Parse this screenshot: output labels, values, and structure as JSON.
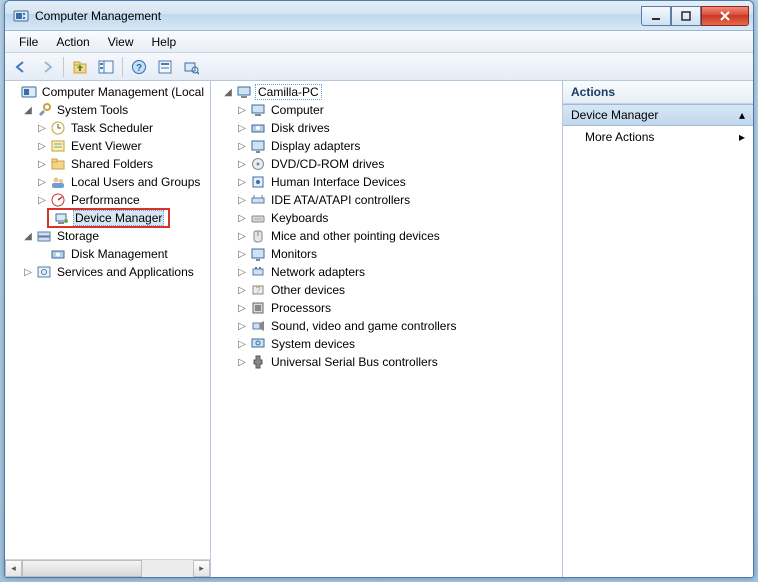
{
  "window": {
    "title": "Computer Management"
  },
  "menu": {
    "file": "File",
    "action": "Action",
    "view": "View",
    "help": "Help"
  },
  "left_tree": {
    "root": "Computer Management (Local",
    "system_tools": {
      "label": "System Tools",
      "items": [
        "Task Scheduler",
        "Event Viewer",
        "Shared Folders",
        "Local Users and Groups",
        "Performance",
        "Device Manager"
      ]
    },
    "storage": {
      "label": "Storage",
      "items": [
        "Disk Management"
      ]
    },
    "services": {
      "label": "Services and Applications"
    }
  },
  "mid_tree": {
    "root": "Camilla-PC",
    "items": [
      "Computer",
      "Disk drives",
      "Display adapters",
      "DVD/CD-ROM drives",
      "Human Interface Devices",
      "IDE ATA/ATAPI controllers",
      "Keyboards",
      "Mice and other pointing devices",
      "Monitors",
      "Network adapters",
      "Other devices",
      "Processors",
      "Sound, video and game controllers",
      "System devices",
      "Universal Serial Bus controllers"
    ]
  },
  "actions": {
    "header": "Actions",
    "group": "Device Manager",
    "more": "More Actions"
  }
}
